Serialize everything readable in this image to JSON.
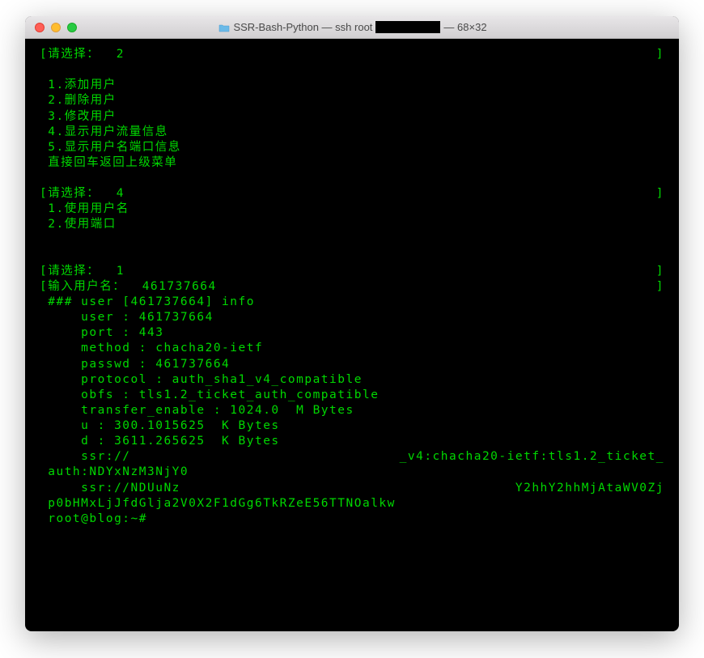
{
  "window": {
    "title_prefix": "SSR-Bash-Python — ssh root",
    "title_suffix": " — 68×32"
  },
  "lines": {
    "prompt1": "[请选择：  2",
    "prompt1_close": "]",
    "menu1_1": " 1.添加用户",
    "menu1_2": " 2.删除用户",
    "menu1_3": " 3.修改用户",
    "menu1_4": " 4.显示用户流量信息",
    "menu1_5": " 5.显示用户名端口信息",
    "menu1_back": " 直接回车返回上级菜单",
    "prompt2": "[请选择：  4",
    "prompt2_close": "]",
    "menu2_1": " 1.使用用户名",
    "menu2_2": " 2.使用端口",
    "prompt3": "[请选择：  1",
    "prompt3_close": "]",
    "prompt4": "[输入用户名：  461737664",
    "prompt4_close": "]",
    "info_header": " ### user [461737664] info",
    "info_user": "     user : 461737664",
    "info_port": "     port : 443",
    "info_method": "     method : chacha20-ietf",
    "info_passwd": "     passwd : 461737664",
    "info_protocol": "     protocol : auth_sha1_v4_compatible",
    "info_obfs": "     obfs : tls1.2_ticket_auth_compatible",
    "info_transfer": "     transfer_enable : 1024.0  M Bytes",
    "info_u": "     u : 300.1015625  K Bytes",
    "info_d": "     d : 3611.265625  K Bytes",
    "info_ssr1_left": "     ssr://",
    "info_ssr1_right": "_v4:chacha20-ietf:tls1.2_ticket_",
    "info_ssr1_cont": " auth:NDYxNzM3NjY0",
    "info_ssr2_left": "     ssr://NDUuNz",
    "info_ssr2_right": "Y2hhY2hhMjAtaWV0Zj",
    "info_ssr2_cont": " p0bHMxLjJfdGlja2V0X2F1dGg6TkRZeE56TTNOalkw",
    "root_prompt": " root@blog:~#"
  }
}
